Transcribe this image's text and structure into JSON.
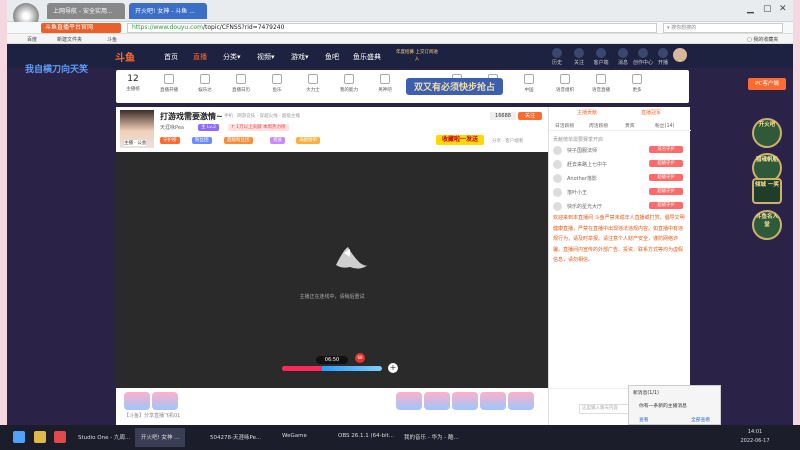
{
  "browser": {
    "tabs": [
      "上网导航 - 安全实用...",
      "开火吧! 女神 - 斗鱼 ..."
    ],
    "site_button": "斗鱼直播平台官网",
    "url_host": "https://www.douyu.com",
    "url_path": "/topic/CFNSS?rid=7479240",
    "search_placeholder": "▾ 搜你想搜的",
    "favorites": [
      "百度",
      "新建文件夹",
      "斗鱼"
    ],
    "favorites_right": "▢ 我的收藏夹"
  },
  "site_nav": {
    "logo": "斗鱼",
    "items": [
      "首页",
      "直播",
      "分类▾",
      "视频▾",
      "游戏▾",
      "鱼吧",
      "鱼乐盛典"
    ],
    "promo": "年度招募 上交订阅进入",
    "right_items": [
      "历史",
      "关注",
      "客户端",
      "消息",
      "创作中心",
      "开播"
    ]
  },
  "decor_left": "我自横刀向天笑",
  "category_bar": {
    "items": [
      {
        "label": "主播榜",
        "big": "12"
      },
      {
        "label": "直播开播"
      },
      {
        "label": "娱乐达"
      },
      {
        "label": "直播日历"
      },
      {
        "label": "鱼乐"
      },
      {
        "label": "大力士"
      },
      {
        "label": "我的能力"
      },
      {
        "label": "男神吧"
      },
      {
        "label": "直播工具"
      },
      {
        "label": "英雄联盟"
      },
      {
        "label": "中国"
      },
      {
        "label": "语音组织"
      },
      {
        "label": "语音直播"
      },
      {
        "label": "更多"
      }
    ],
    "banner": "双又有必须快步抢占",
    "pc_button": "PC客户端"
  },
  "room": {
    "title": "打游戏需要激情~",
    "tags": "手机 · 网游竞技 · 穿越火线 · 超级主播",
    "host_name": "天涯咏Pea",
    "host_label": "主播 · 公会",
    "levels": [
      "主 Lv.2",
      "↑ 1万以上贡献 本周热力榜"
    ],
    "badges": [
      "守护榜",
      "粉丝团",
      "超级粉丝团",
      "贵族",
      "贡献榜单"
    ],
    "follow_count": "16688",
    "follow_label": "关注",
    "share_text": "分享 · 客户端看",
    "yellow_button": "收藏啦一发送"
  },
  "player": {
    "loading_text": "主播正在连线中，请稍后重试",
    "timer": "06:50",
    "timer_badge": "68"
  },
  "gift_bar": {
    "label": "【斗鱼】分享直播飞机01"
  },
  "side_panel": {
    "top_tabs": [
      "主播贡献",
      "直播冠军"
    ],
    "tabs": [
      "日活跃榜",
      "周活跃榜",
      "贵宾",
      "粉丝(14)"
    ],
    "rank_header": "贡献榜单需要赛季开启",
    "rank_rows": [
      {
        "name": "快子国服法师",
        "tag": "成名守护"
      },
      {
        "name": "赶去来路上七中午",
        "tag": "超级守护"
      },
      {
        "name": "Another落影",
        "tag": "超级守护"
      },
      {
        "name": "落叶小王",
        "tag": "超级守护"
      },
      {
        "name": "快乐的星光大厅",
        "tag": "超级守护"
      }
    ],
    "notice": "欢迎来到本直播间 斗鱼严禁未成年人直播或打赏，倡导文明健康直播，严禁在直播中出现违法违规内容。如直播中有违规行为，请及时举报。请注意个人财产安全，谨防网络诈骗。直播间内宣传的外部广告、投资、联系方式等均为虚假信息，请勿相信。",
    "chat_placeholder": "这里输入聊天内容",
    "send_label": "发送"
  },
  "popup": {
    "title": "新消息(1/1)",
    "body": "你有一条新的主播消息",
    "action_left": "查看",
    "action_right": "全部查看"
  },
  "right_decor": [
    "开火吧",
    "猎魂帆船",
    "倾城 一笑",
    "斗鱼名人堂"
  ],
  "taskbar": {
    "items": [
      "Studio One - 九周...",
      "开火吧! 女神 ...",
      "504278-天涯咏Pe...",
      "WeGame",
      "OBS 26.1.1 (64-bit...",
      "我的音乐 - 华为 - 酷..."
    ],
    "time": "14:01",
    "date": "2022-06-17"
  }
}
